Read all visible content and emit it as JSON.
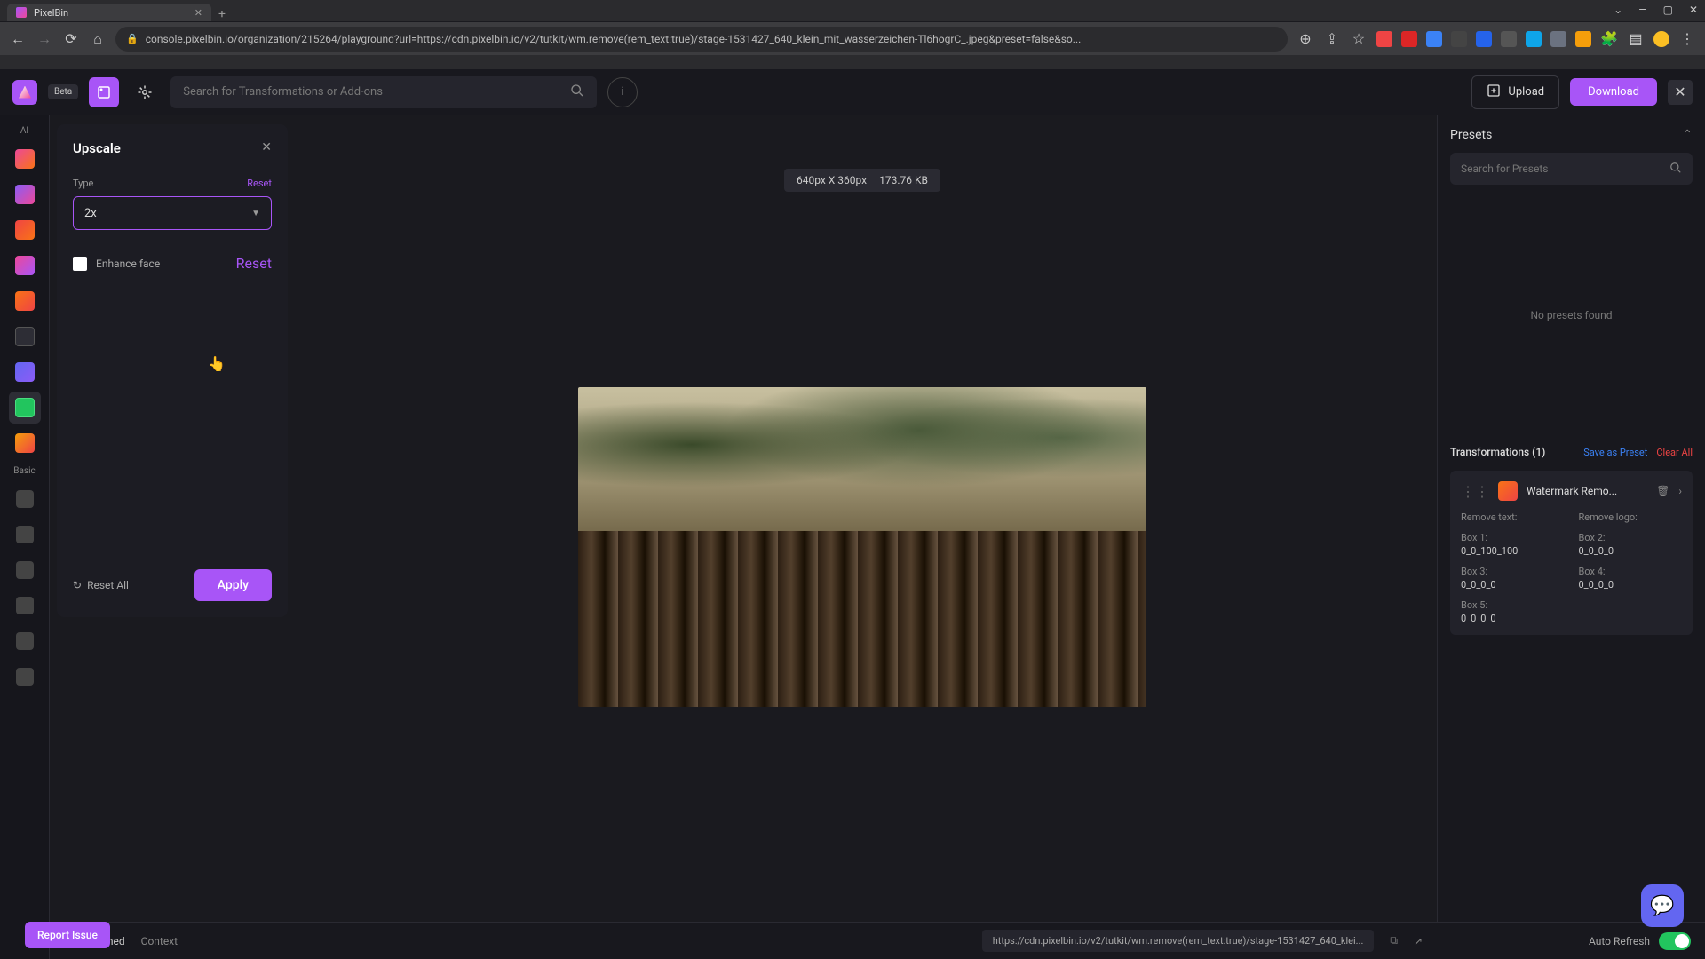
{
  "browser": {
    "tab_title": "PixelBin",
    "url": "console.pixelbin.io/organization/215264/playground?url=https://cdn.pixelbin.io/v2/tutkit/wm.remove(rem_text:true)/stage-1531427_640_klein_mit_wasserzeichen-Tl6hogrC_.jpeg&preset=false&so..."
  },
  "header": {
    "beta": "Beta",
    "search_placeholder": "Search for Transformations or Add-ons",
    "upload": "Upload",
    "download": "Download"
  },
  "left_rail": {
    "ai_label": "AI",
    "basic_label": "Basic"
  },
  "panel": {
    "title": "Upscale",
    "type_label": "Type",
    "type_reset": "Reset",
    "type_value": "2x",
    "enhance_label": "Enhance face",
    "enhance_reset": "Reset",
    "reset_all": "Reset All",
    "apply": "Apply"
  },
  "canvas": {
    "dimensions": "640px X 360px",
    "filesize": "173.76 KB"
  },
  "right": {
    "presets_title": "Presets",
    "presets_placeholder": "Search for Presets",
    "no_presets": "No presets found",
    "trans_title": "Transformations (1)",
    "save_preset": "Save as Preset",
    "clear_all": "Clear All",
    "item_name": "Watermark Remo...",
    "remove_text_label": "Remove text:",
    "remove_logo_label": "Remove logo:",
    "box1_label": "Box 1:",
    "box1_val": "0_0_100_100",
    "box2_label": "Box 2:",
    "box2_val": "0_0_0_0",
    "box3_label": "Box 3:",
    "box3_val": "0_0_0_0",
    "box4_label": "Box 4:",
    "box4_val": "0_0_0_0",
    "box5_label": "Box 5:",
    "box5_val": "0_0_0_0"
  },
  "bottom": {
    "transformed_tab": "Transformed",
    "context_tab": "Context",
    "url": "https://cdn.pixelbin.io/v2/tutkit/wm.remove(rem_text:true)/stage-1531427_640_klei...",
    "auto_refresh": "Auto Refresh"
  },
  "report_issue": "Report Issue"
}
